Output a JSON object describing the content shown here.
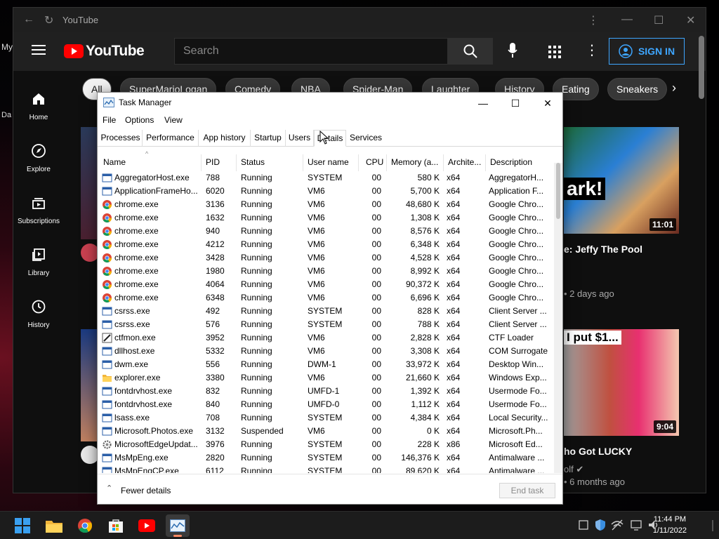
{
  "desktop": {
    "fragments": [
      "My",
      "Da"
    ]
  },
  "youtube": {
    "window_title": "YouTube",
    "logo_text": "YouTube",
    "search_placeholder": "Search",
    "signin_label": "SIGN IN",
    "sidebar": [
      {
        "label": "Home",
        "icon": "home-icon"
      },
      {
        "label": "Explore",
        "icon": "compass-icon"
      },
      {
        "label": "Subscriptions",
        "icon": "subscriptions-icon"
      },
      {
        "label": "Library",
        "icon": "library-icon"
      },
      {
        "label": "History",
        "icon": "history-icon"
      }
    ],
    "chips": [
      "All",
      "SuperMarioLogan",
      "Comedy",
      "NBA",
      "Spider-Man",
      "Laughter",
      "History",
      "Eating",
      "Sneakers"
    ],
    "videos": [
      {
        "title": "e: Jeffy The Pool",
        "meta": "• 2 days ago",
        "duration": "11:01",
        "thumb_text": "ark!"
      },
      {
        "title": "ho Got LUCKY",
        "channel": "olf",
        "meta": "• 6 months ago",
        "duration": "9:04",
        "thumb_text": "I put $1..."
      }
    ]
  },
  "task_manager": {
    "title": "Task Manager",
    "menu": [
      "File",
      "Options",
      "View"
    ],
    "tabs": [
      "Processes",
      "Performance",
      "App history",
      "Startup",
      "Users",
      "Details",
      "Services"
    ],
    "active_tab": "Details",
    "columns": [
      "Name",
      "PID",
      "Status",
      "User name",
      "CPU",
      "Memory (a...",
      "Archite...",
      "Description"
    ],
    "rows": [
      {
        "name": "AggregatorHost.exe",
        "pid": "788",
        "status": "Running",
        "user": "SYSTEM",
        "cpu": "00",
        "memory": "580 K",
        "arch": "x64",
        "desc": "AggregatorH...",
        "icon": "window"
      },
      {
        "name": "ApplicationFrameHo...",
        "pid": "6020",
        "status": "Running",
        "user": "VM6",
        "cpu": "00",
        "memory": "5,700 K",
        "arch": "x64",
        "desc": "Application F...",
        "icon": "window"
      },
      {
        "name": "chrome.exe",
        "pid": "3136",
        "status": "Running",
        "user": "VM6",
        "cpu": "00",
        "memory": "48,680 K",
        "arch": "x64",
        "desc": "Google Chro...",
        "icon": "chrome"
      },
      {
        "name": "chrome.exe",
        "pid": "1632",
        "status": "Running",
        "user": "VM6",
        "cpu": "00",
        "memory": "1,308 K",
        "arch": "x64",
        "desc": "Google Chro...",
        "icon": "chrome"
      },
      {
        "name": "chrome.exe",
        "pid": "940",
        "status": "Running",
        "user": "VM6",
        "cpu": "00",
        "memory": "8,576 K",
        "arch": "x64",
        "desc": "Google Chro...",
        "icon": "chrome"
      },
      {
        "name": "chrome.exe",
        "pid": "4212",
        "status": "Running",
        "user": "VM6",
        "cpu": "00",
        "memory": "6,348 K",
        "arch": "x64",
        "desc": "Google Chro...",
        "icon": "chrome"
      },
      {
        "name": "chrome.exe",
        "pid": "3428",
        "status": "Running",
        "user": "VM6",
        "cpu": "00",
        "memory": "4,528 K",
        "arch": "x64",
        "desc": "Google Chro...",
        "icon": "chrome"
      },
      {
        "name": "chrome.exe",
        "pid": "1980",
        "status": "Running",
        "user": "VM6",
        "cpu": "00",
        "memory": "8,992 K",
        "arch": "x64",
        "desc": "Google Chro...",
        "icon": "chrome"
      },
      {
        "name": "chrome.exe",
        "pid": "4064",
        "status": "Running",
        "user": "VM6",
        "cpu": "00",
        "memory": "90,372 K",
        "arch": "x64",
        "desc": "Google Chro...",
        "icon": "chrome"
      },
      {
        "name": "chrome.exe",
        "pid": "6348",
        "status": "Running",
        "user": "VM6",
        "cpu": "00",
        "memory": "6,696 K",
        "arch": "x64",
        "desc": "Google Chro...",
        "icon": "chrome"
      },
      {
        "name": "csrss.exe",
        "pid": "492",
        "status": "Running",
        "user": "SYSTEM",
        "cpu": "00",
        "memory": "828 K",
        "arch": "x64",
        "desc": "Client Server ...",
        "icon": "window"
      },
      {
        "name": "csrss.exe",
        "pid": "576",
        "status": "Running",
        "user": "SYSTEM",
        "cpu": "00",
        "memory": "788 K",
        "arch": "x64",
        "desc": "Client Server ...",
        "icon": "window"
      },
      {
        "name": "ctfmon.exe",
        "pid": "3952",
        "status": "Running",
        "user": "VM6",
        "cpu": "00",
        "memory": "2,828 K",
        "arch": "x64",
        "desc": "CTF Loader",
        "icon": "pen"
      },
      {
        "name": "dllhost.exe",
        "pid": "5332",
        "status": "Running",
        "user": "VM6",
        "cpu": "00",
        "memory": "3,308 K",
        "arch": "x64",
        "desc": "COM Surrogate",
        "icon": "window"
      },
      {
        "name": "dwm.exe",
        "pid": "556",
        "status": "Running",
        "user": "DWM-1",
        "cpu": "00",
        "memory": "33,972 K",
        "arch": "x64",
        "desc": "Desktop Win...",
        "icon": "window"
      },
      {
        "name": "explorer.exe",
        "pid": "3380",
        "status": "Running",
        "user": "VM6",
        "cpu": "00",
        "memory": "21,660 K",
        "arch": "x64",
        "desc": "Windows Exp...",
        "icon": "folder"
      },
      {
        "name": "fontdrvhost.exe",
        "pid": "832",
        "status": "Running",
        "user": "UMFD-1",
        "cpu": "00",
        "memory": "1,392 K",
        "arch": "x64",
        "desc": "Usermode Fo...",
        "icon": "window"
      },
      {
        "name": "fontdrvhost.exe",
        "pid": "840",
        "status": "Running",
        "user": "UMFD-0",
        "cpu": "00",
        "memory": "1,112 K",
        "arch": "x64",
        "desc": "Usermode Fo...",
        "icon": "window"
      },
      {
        "name": "lsass.exe",
        "pid": "708",
        "status": "Running",
        "user": "SYSTEM",
        "cpu": "00",
        "memory": "4,384 K",
        "arch": "x64",
        "desc": "Local Security...",
        "icon": "window"
      },
      {
        "name": "Microsoft.Photos.exe",
        "pid": "3132",
        "status": "Suspended",
        "user": "VM6",
        "cpu": "00",
        "memory": "0 K",
        "arch": "x64",
        "desc": "Microsoft.Ph...",
        "icon": "window"
      },
      {
        "name": "MicrosoftEdgeUpdat...",
        "pid": "3976",
        "status": "Running",
        "user": "SYSTEM",
        "cpu": "00",
        "memory": "228 K",
        "arch": "x86",
        "desc": "Microsoft Ed...",
        "icon": "gear"
      },
      {
        "name": "MsMpEng.exe",
        "pid": "2820",
        "status": "Running",
        "user": "SYSTEM",
        "cpu": "00",
        "memory": "146,376 K",
        "arch": "x64",
        "desc": "Antimalware ...",
        "icon": "window"
      },
      {
        "name": "MsMpEngCP.exe",
        "pid": "6112",
        "status": "Running",
        "user": "SYSTEM",
        "cpu": "00",
        "memory": "89,620 K",
        "arch": "x64",
        "desc": "Antimalware ...",
        "icon": "window"
      }
    ],
    "fewer_details_label": "Fewer details",
    "end_task_label": "End task"
  },
  "taskbar": {
    "time": "11:44 PM",
    "date": "1/11/2022",
    "apps": [
      "start-icon",
      "file-explorer-icon",
      "chrome-icon",
      "store-icon",
      "youtube-icon",
      "task-manager-icon"
    ]
  },
  "colors": {
    "yt_red": "#ff0000",
    "signin_blue": "#3ea6ff",
    "taskbar_accent": "#ff8a64"
  }
}
